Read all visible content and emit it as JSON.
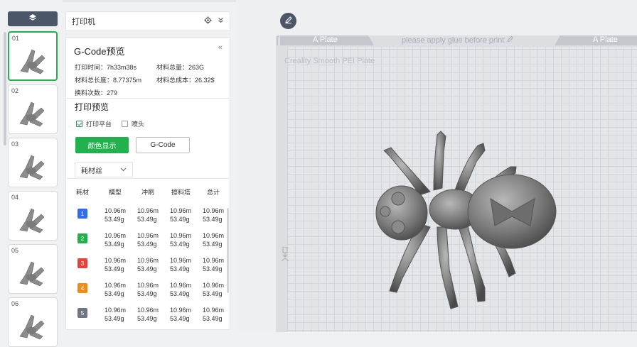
{
  "printer": {
    "title": "打印机"
  },
  "gcode": {
    "title": "G-Code预览",
    "stats": {
      "print_time": "打印时间：7h33m38s",
      "total_weight": "材料总量：263G",
      "total_length": "材料总长度：8.77375m",
      "total_cost": "材料总成本：26.32$",
      "changes": "换料次数：279"
    },
    "preview_title": "打印预览",
    "checkboxes": [
      {
        "label": "打印平台",
        "checked": true
      },
      {
        "label": "喷头",
        "checked": false
      }
    ],
    "color_button": "颜色显示",
    "gcode_button": "G-Code",
    "select_value": "耗材丝",
    "table": {
      "headers": [
        "耗材",
        "模型",
        "冲刷",
        "擦料塔",
        "总计"
      ],
      "rows": [
        {
          "id": "1",
          "color": "#2f6df0",
          "cells": [
            [
              "10.96m",
              "53.49g"
            ],
            [
              "10.96m",
              "53.49g"
            ],
            [
              "10.96m",
              "53.49g"
            ],
            [
              "10.96m",
              "53.49g"
            ]
          ]
        },
        {
          "id": "2",
          "color": "#22b14c",
          "cells": [
            [
              "10.96m",
              "53.49g"
            ],
            [
              "10.96m",
              "53.49g"
            ],
            [
              "10.96m",
              "53.49g"
            ],
            [
              "10.96m",
              "53.49g"
            ]
          ]
        },
        {
          "id": "3",
          "color": "#e8413a",
          "cells": [
            [
              "10.96m",
              "53.49g"
            ],
            [
              "10.96m",
              "53.49g"
            ],
            [
              "10.96m",
              "53.49g"
            ],
            [
              "10.96m",
              "53.49g"
            ]
          ]
        },
        {
          "id": "4",
          "color": "#f28c17",
          "cells": [
            [
              "10.96m",
              "53.49g"
            ],
            [
              "10.96m",
              "53.49g"
            ],
            [
              "10.96m",
              "53.49g"
            ],
            [
              "10.96m",
              "53.49g"
            ]
          ]
        },
        {
          "id": "5",
          "color": "#6f7680",
          "cells": [
            [
              "10.96m",
              "53.49g"
            ],
            [
              "10.96m",
              "53.49g"
            ],
            [
              "10.96m",
              "53.49g"
            ],
            [
              "10.96m",
              "53.49g"
            ]
          ]
        }
      ]
    }
  },
  "thumbnails": [
    "01",
    "02",
    "03",
    "04",
    "05",
    "06"
  ],
  "plate": {
    "left_label": "A Plate",
    "right_label": "A Plate",
    "glue_hint": "please apply glue before print",
    "plate_type": "Creality Smooth PEI Plate"
  },
  "colors": {
    "accent": "#22b14c",
    "dark_button": "#4b5668"
  }
}
